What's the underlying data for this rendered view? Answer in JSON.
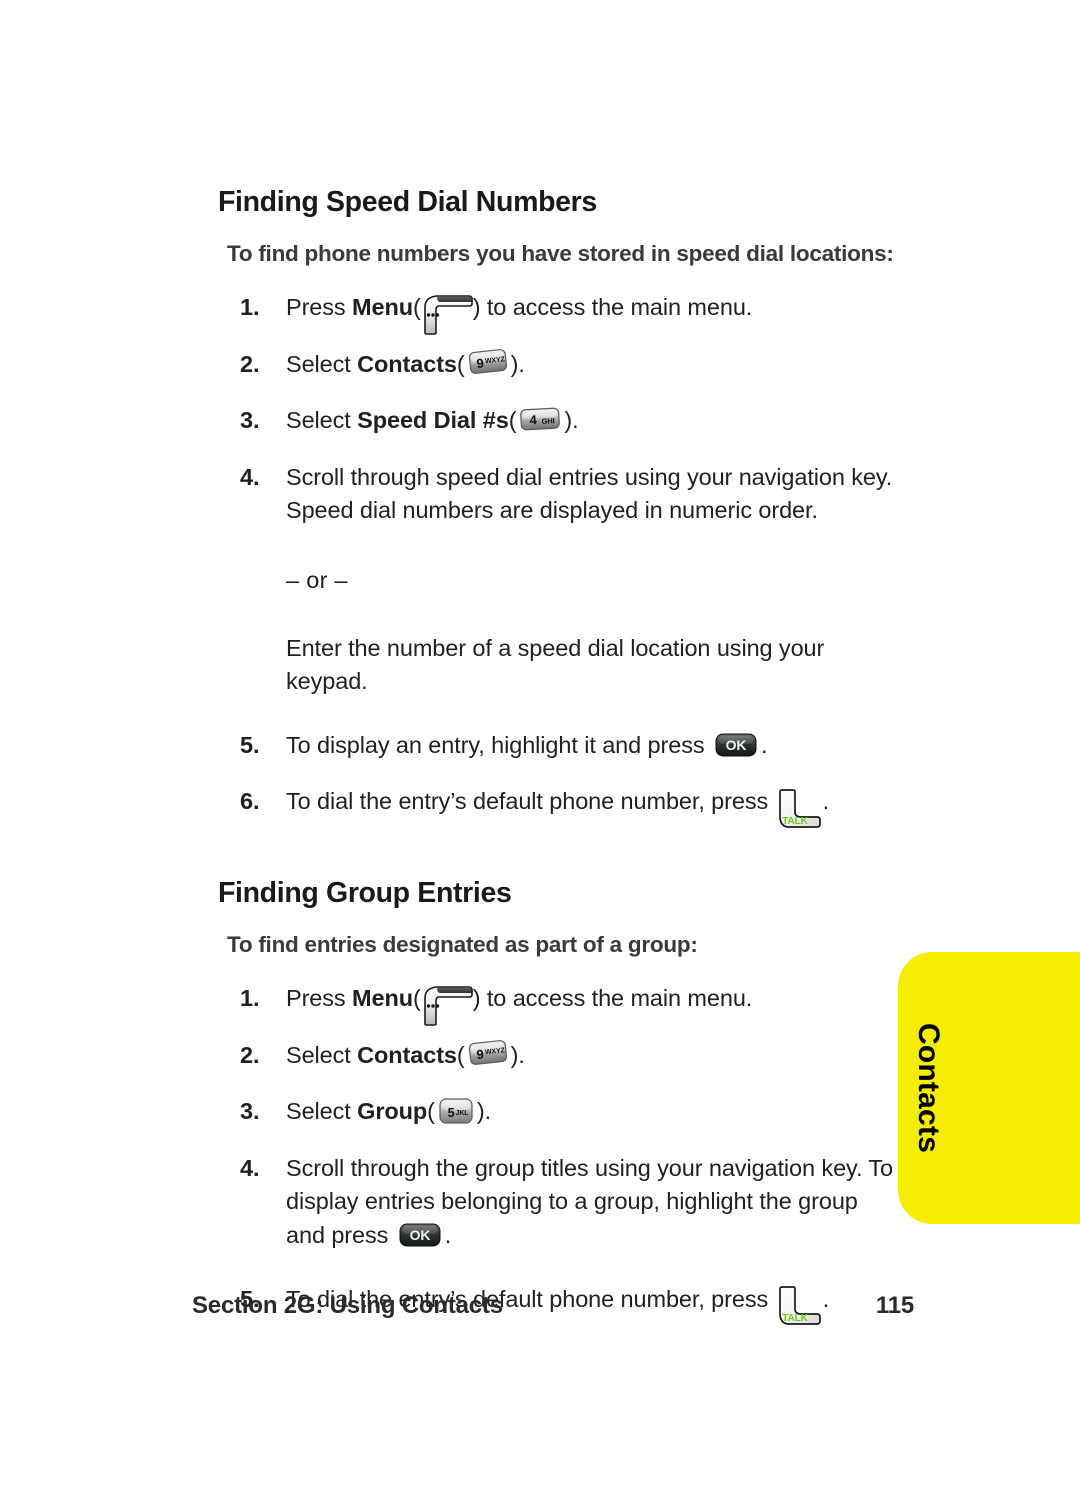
{
  "page": {
    "accent_yellow": "#f5ed00",
    "text_color": "#231f20",
    "talk_green": "#6ec81e"
  },
  "side_tab": {
    "label": "Contacts"
  },
  "sections": [
    {
      "heading": "Finding Speed Dial Numbers",
      "lead": "To find phone numbers you have stored in speed dial locations:",
      "steps": [
        {
          "num": "1.",
          "pre": "Press ",
          "bold": "Menu",
          "key": "menu-softkey",
          "post": " to access the main menu."
        },
        {
          "num": "2.",
          "pre": "Select ",
          "bold": "Contacts",
          "key": "key-9-wxyz",
          "post": "."
        },
        {
          "num": "3.",
          "pre": "Select ",
          "bold": "Speed Dial #s",
          "key": "key-4-ghi",
          "post": "."
        },
        {
          "num": "4.",
          "text": "Scroll through speed dial entries using your navigation key. Speed dial numbers are displayed in numeric order."
        },
        {
          "num": "5.",
          "pre": "To display an entry, highlight it and press ",
          "key": "ok-key",
          "post": "."
        },
        {
          "num": "6.",
          "pre": "To dial the entry’s default phone number, press ",
          "key": "talk-key",
          "post": "."
        }
      ],
      "or_divider": "– or –",
      "alt_text": "Enter the number of a speed dial location using your keypad."
    },
    {
      "heading": "Finding Group Entries",
      "lead": "To find entries designated as part of a group:",
      "steps": [
        {
          "num": "1.",
          "pre": "Press ",
          "bold": "Menu",
          "key": "menu-softkey",
          "post": " to access the main menu."
        },
        {
          "num": "2.",
          "pre": "Select ",
          "bold": "Contacts",
          "key": "key-9-wxyz",
          "post": "."
        },
        {
          "num": "3.",
          "pre": "Select ",
          "bold": "Group",
          "key": "key-5-jkl",
          "post": "."
        },
        {
          "num": "4.",
          "pre": "Scroll through the group titles using your navigation key. To display entries belonging to a group, highlight the group and press ",
          "key": "ok-key",
          "post": "."
        },
        {
          "num": "5.",
          "pre": "To dial the entry’s default phone number, press ",
          "key": "talk-key",
          "post": "."
        }
      ]
    }
  ],
  "keys": {
    "key_9_label": "9",
    "key_9_letters": "WXYZ",
    "key_4_label": "4",
    "key_4_letters": "GHI",
    "key_5_label": "5",
    "key_5_letters": "JKL",
    "ok_label": "OK",
    "talk_label": "TALK",
    "menu_dots": "•••"
  },
  "paren": {
    "open": "(",
    "close": ")"
  },
  "footer": {
    "section": "Section 2G: Using Contacts",
    "page_number": "115"
  }
}
